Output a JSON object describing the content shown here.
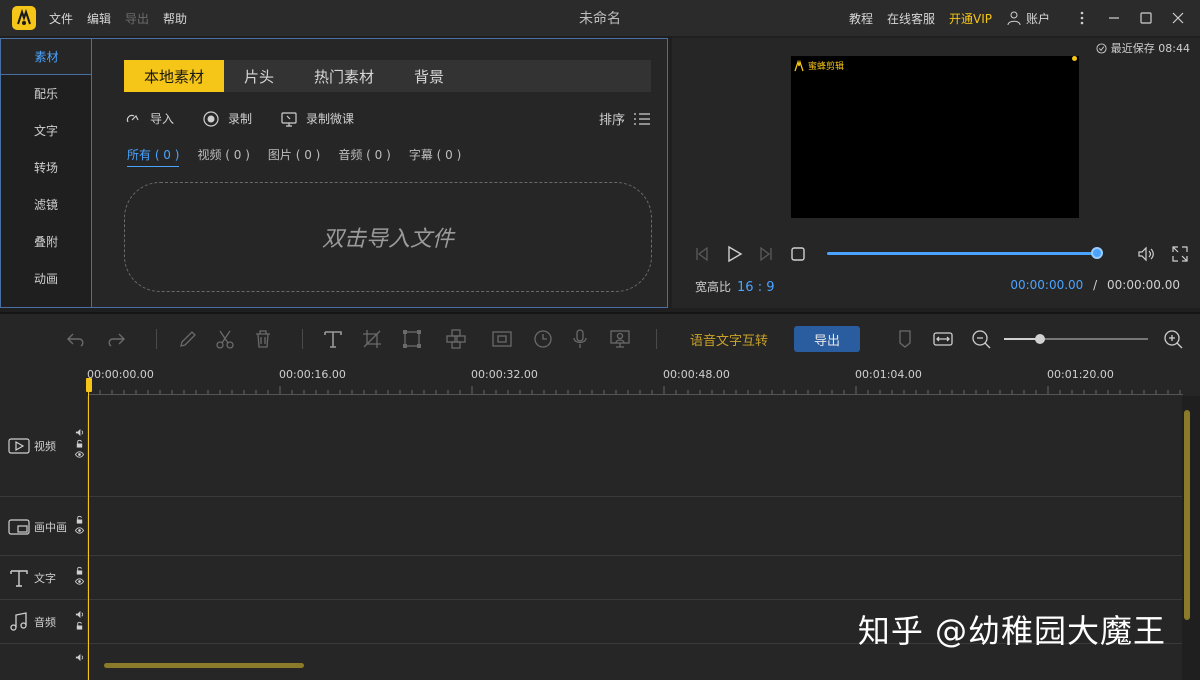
{
  "titlebar": {
    "menu": [
      "文件",
      "编辑",
      "导出",
      "帮助"
    ],
    "title": "未命名",
    "links": [
      "教程",
      "在线客服"
    ],
    "vip": "开通VIP",
    "account": "账户"
  },
  "sidenav": [
    "素材",
    "配乐",
    "文字",
    "转场",
    "滤镜",
    "叠附",
    "动画"
  ],
  "tabs": [
    "本地素材",
    "片头",
    "热门素材",
    "背景"
  ],
  "actions": {
    "import": "导入",
    "record": "录制",
    "record_course": "录制微课",
    "sort": "排序"
  },
  "filters": [
    "所有 ( 0 )",
    "视频 ( 0 )",
    "图片 ( 0 )",
    "音频 ( 0 )",
    "字幕 ( 0 )"
  ],
  "dropzone_text": "双击导入文件",
  "preview": {
    "saved": "最近保存 08:44",
    "watermark": "蜜蜂剪辑",
    "ratio_label": "宽高比",
    "ratio_value": "16 : 9",
    "current_time": "00:00:00.00",
    "separator": "/",
    "total_time": "00:00:00.00",
    "progress": 1.0
  },
  "toolbar": {
    "speech_text": "语音文字互转",
    "export": "导出",
    "zoom_level": 0.25
  },
  "ruler": [
    "00:00:00.00",
    "00:00:16.00",
    "00:00:32.00",
    "00:00:48.00",
    "00:01:04.00",
    "00:01:20.00"
  ],
  "tracks": [
    "视频",
    "画中画",
    "文字",
    "音频"
  ],
  "site_watermark": "知乎 @幼稚园大魔王"
}
